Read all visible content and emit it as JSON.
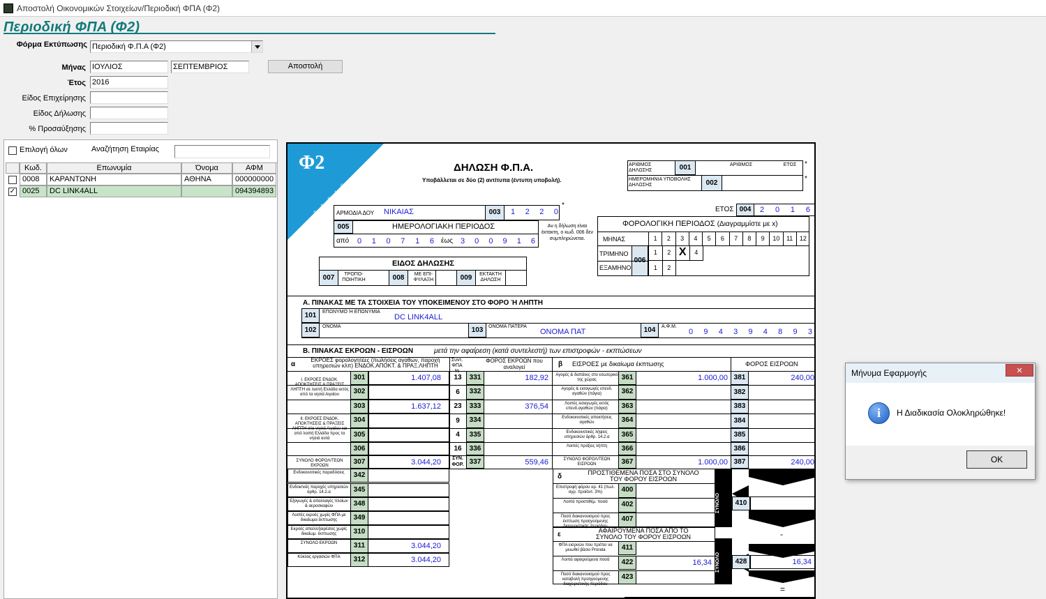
{
  "window": {
    "title": "Αποστολή Οικονομικών Στοιχείων/Περιοδική ΦΠΑ (Φ2)"
  },
  "page_title": "Περιοδική ΦΠΑ (Φ2)",
  "filters": {
    "print_form_label": "Φόρμα Εκτύπωσης",
    "print_form_value": "Περιοδική Φ.Π.Α (Φ2)",
    "month_label": "Μήνας",
    "month_from": "ΙΟΥΛΙΟΣ",
    "month_to": "ΣΕΠΤΕΜΒΡΙΟΣ",
    "send_button": "Αποστολή",
    "year_label": "Έτος",
    "year_value": "2016",
    "business_type_label": "Είδος Επιχείρησης",
    "declaration_type_label": "Είδος Δήλωσης",
    "surcharge_label": "% Προσαύξησης"
  },
  "company_list": {
    "select_all_label": "Επιλογή όλων",
    "search_label": "Αναζήτηση Εταιρίας",
    "columns": [
      "Κωδ.",
      "Επωνυμία",
      "Όνομα",
      "ΑΦΜ"
    ],
    "rows": [
      {
        "code": "0008",
        "name": "ΚΑΡΑΝΤΩΝΗ",
        "first": "ΑΘΗΝΑ",
        "afm": "000000000",
        "checked": false
      },
      {
        "code": "0025",
        "name": "DC LINK4ALL",
        "first": "",
        "afm": "094394893",
        "checked": true
      }
    ]
  },
  "form": {
    "logo": "Φ2",
    "logo_sub": "T A X I S",
    "title": "ΔΗΛΩΣΗ Φ.Π.Α.",
    "subtitle": "Υποβάλλεται σε δύο (2) αντίτυπα (έντυπη υποβολή).",
    "decl_number_label": "ΑΡΙΘΜΟΣ ΔΗΛΩΣΗΣ",
    "code_001": "001",
    "number_label": "ΑΡΙΘΜΟΣ",
    "year_small_label": "ΕΤΟΣ",
    "submit_date_label": "ΗΜΕΡΟΜΗΝΙΑ ΥΠΟΒΟΛΗΣ ΔΗΛΩΣΗΣ",
    "code_002": "002",
    "star": "*",
    "doy_label": "ΑΡΜΟΔΙΑ ΔΟΥ",
    "doy_value": "ΝΙΚΑΙΑΣ",
    "code_003": "003",
    "doy_code": [
      "1",
      "2",
      "2",
      "0"
    ],
    "year_label": "ΕΤΟΣ",
    "code_004": "004",
    "year_digits": [
      "2",
      "0",
      "1",
      "6"
    ],
    "code_005": "005",
    "calendar_period": "ΗΜΕΡΟΛΟΓΙΑΚΗ ΠΕΡΙΟΔΟΣ",
    "from_label": "από",
    "from_digits": [
      "0",
      "1",
      "0",
      "7",
      "1",
      "6"
    ],
    "to_label": "έως",
    "to_digits": [
      "3",
      "0",
      "0",
      "9",
      "1",
      "6"
    ],
    "note_extra": "Αν η δήλωση είναι έκτακτη, ο κωδ. 006 δεν συμπληρώνεται.",
    "tax_period_title": "ΦΟΡΟΛΟΓΙΚΗ ΠΕΡΙΟΔΟΣ",
    "tax_period_hint": "(Διαγραμμίστε με x)",
    "month_row_label": "ΜΗΝΑΣ",
    "months": [
      "1",
      "2",
      "3",
      "4",
      "5",
      "6",
      "7",
      "8",
      "9",
      "10",
      "11",
      "12"
    ],
    "quarter_label": "ΤΡΙΜΗΝΟ",
    "code_006": "006",
    "quarters": [
      "1",
      "2",
      "X",
      "4"
    ],
    "semester_label": "ΕΞΑΜΗΝΟ",
    "semesters": [
      "1",
      "2"
    ],
    "decl_kind_title": "ΕΙΔΟΣ ΔΗΛΩΣΗΣ",
    "code_007": "007",
    "corrective": "ΤΡΟΠΟ- ΠΟΙΗΤΙΚΗ",
    "code_008": "008",
    "reserved": "ΜΕ ΕΠΙ- ΦΥΛΑΞΗ",
    "code_009": "009",
    "extraordinary": "ΕΚΤΑΚΤΗ ΔΗΛΩΣΗ",
    "section_a": "Α. ΠΙΝΑΚΑΣ ΜΕ ΤΑ ΣΤΟΙΧΕΙΑ ΤΟΥ ΥΠΟΚΕΙΜΕΝΟΥ ΣΤΟ ΦΟΡΟ Ή ΛΗΠΤΗ",
    "code_101": "101",
    "surname_label": "ΕΠΩΝΥΜΟ Ή ΕΠΩΝΥΜΙΑ",
    "surname_value": "DC LINK4ALL",
    "code_102": "102",
    "name_label": "ΟΝΟΜΑ",
    "code_103": "103",
    "father_label": "ΟΝΟΜΑ ΠΑΤΕΡΑ",
    "father_value": "ΟΝΟΜΑ ΠΑΤ",
    "code_104": "104",
    "afm_label": "Α.Φ.Μ.",
    "afm_digits": [
      "0",
      "9",
      "4",
      "3",
      "9",
      "4",
      "8",
      "9",
      "3"
    ],
    "section_b": "Β. ΠΙΝΑΚΑΣ ΕΚΡΟΩΝ - ΕΙΣΡΟΩΝ",
    "section_b_sub": "μετά την αφαίρεση (κατά συντελεστή) των επιστροφών - εκπτώσεων",
    "col_alpha": "α",
    "outputs_head": "ΕΚΡΟΕΣ φορολογητέες (πωλήσεις αγαθών, παροχή υπηρεσιών κλπ) ΕΝΔΟΚ.ΑΠΟΚΤ. & ΠΡΑΞ.ΛΗΠΤΗ",
    "rate_head": "Συντ. ΦΠΑ %",
    "out_tax_head": "ΦΟΡΟΣ ΕΚΡΟΩΝ που αναλογεί",
    "col_beta": "β",
    "inputs_head": "ΕΙΣΡΟΕΣ με δικαίωμα έκπτωσης",
    "in_tax_head": "ΦΟΡΟΣ ΕΙΣΡΟΩΝ",
    "group1_label": "Ι. ΕΚΡΟΕΣ ΕΝΔΟΚ. ΑΠΟΚΤΗΣΕΙΣ & ΠΡΑΞΕΙΣ ΛΗΠΤΗ σε λοιπή Ελλάδα εκτός από τα νησιά Αιγαίου",
    "group2_label": "ΙΙ. ΕΚΡΟΕΣ ΕΝΔΟΚ. ΑΠΟΚΤΗΣΕΙΣ & ΠΡΑΞΕΙΣ ΛΗΠΤΗ στα νησιά Αιγαίου και από λοιπή Ελλάδα προς τα νησιά αυτά",
    "total_outputs_label": "ΣΥΝΟΛΟ ΦΟΡΟΛ/ΤΕΩΝ ΕΚΡΟΩΝ",
    "rows": [
      {
        "code": "301",
        "value": "1.407,08",
        "rate": "13",
        "tcode": "331",
        "tax": "182,92",
        "in_label": "Αγορές & δαπάνες στο εσωτερικό της χώρας",
        "icode": "361",
        "ivalue": "1.000,00",
        "itcode": "381",
        "itax": "240,00"
      },
      {
        "code": "302",
        "value": "",
        "rate": "6",
        "tcode": "332",
        "tax": "",
        "in_label": "Αγορές & εισαγωγές επενδ. αγαθών (πάγια)",
        "icode": "362",
        "ivalue": "",
        "itcode": "382",
        "itax": ""
      },
      {
        "code": "303",
        "value": "1.637,12",
        "rate": "23",
        "tcode": "333",
        "tax": "376,54",
        "in_label": "Λοιπές εισαγωγές εκτός επενδ.αγαθών (πάγια)",
        "icode": "363",
        "ivalue": "",
        "itcode": "383",
        "itax": ""
      },
      {
        "code": "304",
        "value": "",
        "rate": "9",
        "tcode": "334",
        "tax": "",
        "in_label": "Ενδοκοινοτικές αποκτήσεις αγαθών",
        "icode": "364",
        "ivalue": "",
        "itcode": "384",
        "itax": ""
      },
      {
        "code": "305",
        "value": "",
        "rate": "4",
        "tcode": "335",
        "tax": "",
        "in_label": "Ενδοκοινοτικές λήψεις υπηρεσιών άρθρ. 14.2.α",
        "icode": "365",
        "ivalue": "",
        "itcode": "385",
        "itax": ""
      },
      {
        "code": "306",
        "value": "",
        "rate": "16",
        "tcode": "336",
        "tax": "",
        "in_label": "Λοιπές πράξεις λήπτη",
        "icode": "366",
        "ivalue": "",
        "itcode": "386",
        "itax": ""
      },
      {
        "code": "307",
        "value": "3.044,20",
        "rate": "ΣΥΝ. ΦΟΡ.",
        "tcode": "337",
        "tax": "559,46",
        "in_label": "ΣΥΝΟΛΟ ΦΟΡΟΛ/ΤΕΩΝ ΕΙΣΡΟΩΝ",
        "icode": "367",
        "ivalue": "1.000,00",
        "itcode": "387",
        "itax": "240,00"
      }
    ],
    "extra_rows": [
      {
        "label": "Ενδοκοινοτικές παραδόσεις",
        "code": "342",
        "value": ""
      },
      {
        "label": "Ενδοκ/νείς παροχές υπηρεσιών άρθρ. 14.2.α",
        "code": "345",
        "value": ""
      },
      {
        "label": "Εξαγωγές & απαλλαγές πλοίων & αεροσκαφών",
        "code": "348",
        "value": ""
      },
      {
        "label": "Λοιπές εκροές χωρίς ΦΠΑ με δικαίωμα έκπτωσης",
        "code": "349",
        "value": ""
      },
      {
        "label": "Εκροές απαλλ/ξαιρέσεις χωρίς δικαίωμ. έκπτωσης",
        "code": "310",
        "value": ""
      },
      {
        "label": "ΣΥΝΟΛΟ ΕΚΡΟΩΝ",
        "code": "311",
        "value": "3.044,20"
      },
      {
        "label": "Κύκλος εργασιών ΦΠΑ",
        "code": "312",
        "value": "3.044,20"
      }
    ],
    "delta": "δ",
    "added_title": "ΠΡΟΣΤΙΘΕΜΕΝΑ ΠΟΣΑ ΣΤΟ ΣΥΝΟΛΟ ΤΟΥ ΦΟΡΟΥ ΕΙΣΡΟΩΝ",
    "added_rows": [
      {
        "label": "Επιστροφή φόρου αρ. 41 (πωλ. αγρ. προϊόντ. 3%)",
        "code": "400",
        "value": ""
      },
      {
        "label": "Λοιπά προστιθέμ. ποσά",
        "code": "402",
        "value": ""
      },
      {
        "label": "Ποσό διακανονισμού προς έκπτωση προηγούμενης διαχειριστικής περιόδου",
        "code": "407",
        "value": ""
      }
    ],
    "sum_label": "ΣΥΝΟΛΟ",
    "plus": "+",
    "code_410": "410",
    "epsilon": "ε",
    "sub_title": "ΑΦΑΙΡΟΥΜΕΝΑ ΠΟΣΑ ΑΠΟ ΤΟ ΣΥΝΟΛΟ ΤΟΥ ΦΟΡΟΥ ΕΙΣΡΟΩΝ",
    "sub_rows": [
      {
        "label": "ΦΠΑ εισροών που πρέπει να μειωθεί βάσει Prorata",
        "code": "411",
        "value": ""
      },
      {
        "label": "Λοιπά αφαιρούμενα ποσά",
        "code": "422",
        "value": "16,34"
      },
      {
        "label": "Ποσό διακανονισμού προς καταβολή προηγούμενης διαχειριστικής περιόδου",
        "code": "423",
        "value": ""
      }
    ],
    "minus": "-",
    "code_428": "428",
    "val_428": "16,34",
    "equals": "="
  },
  "dialog": {
    "title": "Μήνυμα Εφαρμογής",
    "message": "Η Διαδικασία Ολοκληρώθηκε!",
    "ok": "OK",
    "close": "✕"
  }
}
